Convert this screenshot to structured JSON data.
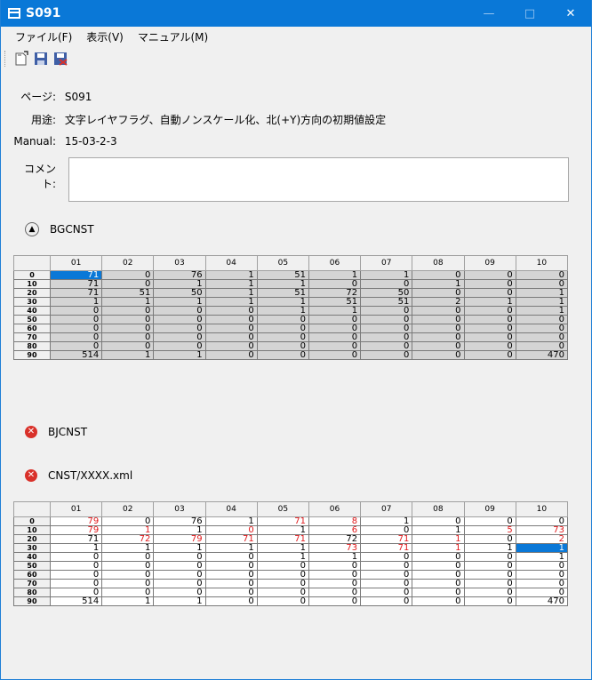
{
  "window": {
    "title": "S091",
    "minimize": "—",
    "maximize": "□",
    "close": "✕"
  },
  "menu": {
    "file": "ファイル(F)",
    "view": "表示(V)",
    "manual": "マニュアル(M)"
  },
  "toolbar": {
    "icons": [
      "new-document-icon",
      "save-icon",
      "save-as-icon"
    ]
  },
  "info": {
    "page_label": "ページ:",
    "page_value": "S091",
    "usage_label": "用途:",
    "usage_value": "文字レイヤフラグ、自動ノンスケール化、北(+Y)方向の初期値設定",
    "manual_label": "Manual:",
    "manual_value": "15-03-2-3",
    "comment_label": "コメント:",
    "comment_value": ""
  },
  "sections": {
    "bgcnst": "BGCNST",
    "bjcnst": "BJCNST",
    "cnst": "CNST/XXXX.xml"
  },
  "columns": [
    "01",
    "02",
    "03",
    "04",
    "05",
    "06",
    "07",
    "08",
    "09",
    "10"
  ],
  "row_labels": [
    "0",
    "10",
    "20",
    "30",
    "40",
    "50",
    "60",
    "70",
    "80",
    "90"
  ],
  "bgcnst_table": [
    [
      "71",
      "0",
      "76",
      "1",
      "51",
      "1",
      "1",
      "0",
      "0",
      "0"
    ],
    [
      "71",
      "0",
      "1",
      "1",
      "1",
      "0",
      "0",
      "1",
      "0",
      "0"
    ],
    [
      "71",
      "51",
      "50",
      "1",
      "51",
      "72",
      "50",
      "0",
      "0",
      "1"
    ],
    [
      "1",
      "1",
      "1",
      "1",
      "1",
      "51",
      "51",
      "2",
      "1",
      "1"
    ],
    [
      "0",
      "0",
      "0",
      "0",
      "1",
      "1",
      "0",
      "0",
      "0",
      "1"
    ],
    [
      "0",
      "0",
      "0",
      "0",
      "0",
      "0",
      "0",
      "0",
      "0",
      "0"
    ],
    [
      "0",
      "0",
      "0",
      "0",
      "0",
      "0",
      "0",
      "0",
      "0",
      "0"
    ],
    [
      "0",
      "0",
      "0",
      "0",
      "0",
      "0",
      "0",
      "0",
      "0",
      "0"
    ],
    [
      "0",
      "0",
      "0",
      "0",
      "0",
      "0",
      "0",
      "0",
      "0",
      "0"
    ],
    [
      "514",
      "1",
      "1",
      "0",
      "0",
      "0",
      "0",
      "0",
      "0",
      "470"
    ]
  ],
  "cnst_table": [
    [
      "79",
      "0",
      "76",
      "1",
      "71",
      "8",
      "1",
      "0",
      "0",
      "0"
    ],
    [
      "79",
      "1",
      "1",
      "0",
      "1",
      "6",
      "0",
      "1",
      "5",
      "73"
    ],
    [
      "71",
      "72",
      "79",
      "71",
      "71",
      "72",
      "71",
      "1",
      "0",
      "2"
    ],
    [
      "1",
      "1",
      "1",
      "1",
      "1",
      "73",
      "71",
      "1",
      "1",
      "1"
    ],
    [
      "0",
      "0",
      "0",
      "0",
      "1",
      "1",
      "0",
      "0",
      "0",
      "1"
    ],
    [
      "0",
      "0",
      "0",
      "0",
      "0",
      "0",
      "0",
      "0",
      "0",
      "0"
    ],
    [
      "0",
      "0",
      "0",
      "0",
      "0",
      "0",
      "0",
      "0",
      "0",
      "0"
    ],
    [
      "0",
      "0",
      "0",
      "0",
      "0",
      "0",
      "0",
      "0",
      "0",
      "0"
    ],
    [
      "0",
      "0",
      "0",
      "0",
      "0",
      "0",
      "0",
      "0",
      "0",
      "0"
    ],
    [
      "514",
      "1",
      "1",
      "0",
      "0",
      "0",
      "0",
      "0",
      "0",
      "470"
    ]
  ],
  "cnst_red_cells": [
    [
      0,
      0
    ],
    [
      0,
      4
    ],
    [
      0,
      5
    ],
    [
      1,
      0
    ],
    [
      1,
      1
    ],
    [
      1,
      3
    ],
    [
      1,
      5
    ],
    [
      1,
      8
    ],
    [
      1,
      9
    ],
    [
      2,
      1
    ],
    [
      2,
      2
    ],
    [
      2,
      3
    ],
    [
      2,
      4
    ],
    [
      2,
      6
    ],
    [
      2,
      7
    ],
    [
      2,
      9
    ],
    [
      3,
      5
    ],
    [
      3,
      6
    ],
    [
      3,
      7
    ]
  ],
  "bgcnst_selected": [
    0,
    0
  ],
  "cnst_selected": [
    3,
    9
  ],
  "colors": {
    "titlebar": "#0a78d7",
    "selection": "#0a78d7",
    "changed_value": "#e0191b",
    "error_icon": "#d9312a"
  }
}
